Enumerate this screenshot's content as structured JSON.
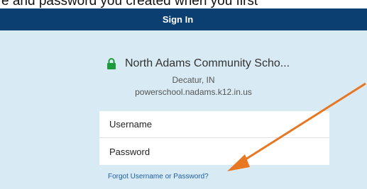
{
  "caption": {
    "text": "e and password you created when you first"
  },
  "header": {
    "title": "Sign In"
  },
  "school": {
    "name": "North Adams Community Scho...",
    "location": "Decatur, IN",
    "domain": "powerschool.nadams.k12.in.us"
  },
  "form": {
    "username_placeholder": "Username",
    "password_placeholder": "Password",
    "forgot_link": "Forgot Username or Password?"
  },
  "colors": {
    "header_bg": "#0b3f72",
    "page_bg": "#d8eaf3",
    "lock_green": "#1e9b3a",
    "arrow_orange": "#e87722",
    "link_blue": "#1f5fa6"
  },
  "icons": {
    "lock": "lock-icon",
    "arrow": "annotation-arrow"
  }
}
